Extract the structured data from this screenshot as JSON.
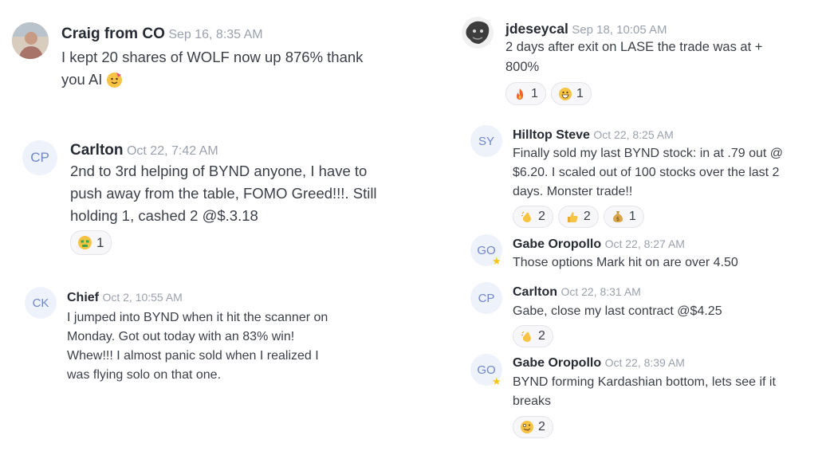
{
  "messages": [
    {
      "id": "craig",
      "author": "Craig from CO",
      "time": "Sep 16, 8:35 AM",
      "lines": [
        "I kept 20 shares of WOLF now up 876% thank",
        "you AI"
      ],
      "inline_emoji": "party-face",
      "reactions": []
    },
    {
      "id": "carlton1",
      "initials": "CP",
      "author": "Carlton",
      "time": "Oct 22, 7:42 AM",
      "lines": [
        "2nd to 3rd helping of BYND anyone, I have to",
        "push away from the table, FOMO Greed!!!. Still",
        "holding 1, cashed 2 @$.3.18"
      ],
      "reactions": [
        {
          "icon": "money-mouth-face",
          "count": "1"
        }
      ]
    },
    {
      "id": "chief",
      "initials": "CK",
      "author": "Chief",
      "time": "Oct 2, 10:55 AM",
      "lines": [
        "I jumped into BYND when it hit the scanner on",
        "Monday. Got out today with an 83% win!",
        "Whew!!! I almost panic sold when I realized I",
        "was flying solo on that one."
      ],
      "reactions": []
    },
    {
      "id": "jdeseycal",
      "author": "jdeseycal",
      "time": "Sep 18, 10:05 AM",
      "lines": [
        "2 days after exit on LASE the trade was at +",
        "800%"
      ],
      "reactions": [
        {
          "icon": "fire",
          "count": "1"
        },
        {
          "icon": "grinning-face",
          "count": "1"
        }
      ]
    },
    {
      "id": "hilltop",
      "initials": "SY",
      "author": "Hilltop Steve",
      "time": "Oct 22, 8:25 AM",
      "lines": [
        "Finally sold my last BYND stock: in at .79 out @",
        "$6.20. I scaled out of 100 stocks over the last 2",
        "days. Monster trade!!"
      ],
      "reactions": [
        {
          "icon": "clapping-hands",
          "count": "2"
        },
        {
          "icon": "thumbs-up",
          "count": "2"
        },
        {
          "icon": "money-bag",
          "count": "1"
        }
      ]
    },
    {
      "id": "gabe1",
      "initials": "GO",
      "author": "Gabe Oropollo",
      "time": "Oct 22, 8:27 AM",
      "lines": [
        "Those options Mark hit on are over 4.50"
      ],
      "reactions": []
    },
    {
      "id": "carlton2",
      "initials": "CP",
      "author": "Carlton",
      "time": "Oct 22, 8:31 AM",
      "lines": [
        "Gabe, close my last contract @$4.25"
      ],
      "reactions": [
        {
          "icon": "clapping-hands",
          "count": "2"
        }
      ]
    },
    {
      "id": "gabe2",
      "initials": "GO",
      "author": "Gabe Oropollo",
      "time": "Oct 22, 8:39 AM",
      "lines": [
        "BYND forming Kardashian bottom, lets see if it",
        "breaks"
      ],
      "reactions": [
        {
          "icon": "zany-face",
          "count": "2"
        }
      ]
    }
  ]
}
